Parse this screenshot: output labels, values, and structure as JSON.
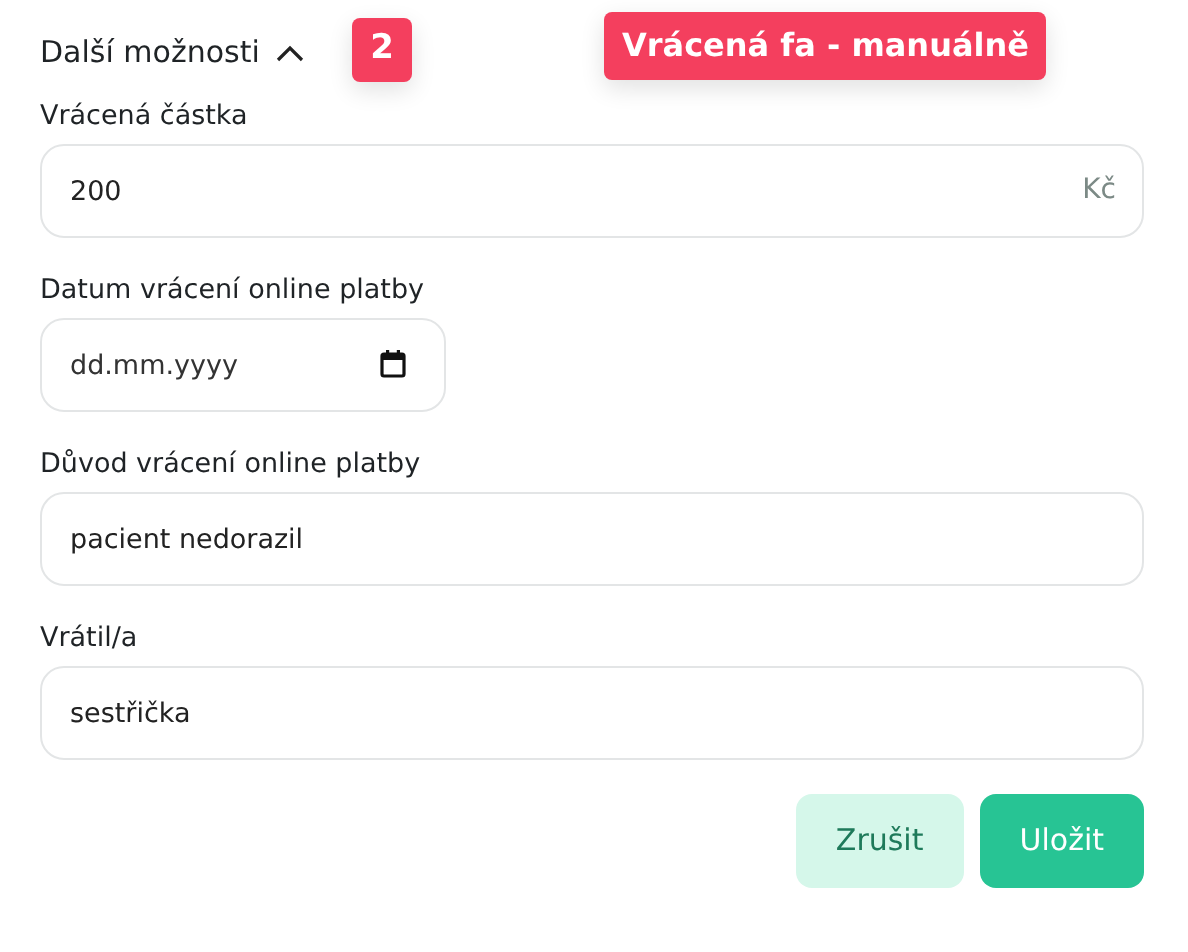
{
  "section": {
    "title": "Další možnosti",
    "expanded": true
  },
  "annotations": [
    {
      "text": "2",
      "kind": "number"
    },
    {
      "text": "Vrácená fa - manuálně",
      "kind": "label"
    }
  ],
  "fields": [
    {
      "kind": "amount",
      "label": "Vrácená částka",
      "value": "200",
      "suffix": "Kč"
    },
    {
      "kind": "date",
      "label": "Datum vrácení online platby",
      "placeholder": "dd.mm.yyyy"
    },
    {
      "kind": "text",
      "label": "Důvod vrácení online platby",
      "value": "pacient nedorazil"
    },
    {
      "kind": "text",
      "label": "Vrátil/a",
      "value": "sestřička"
    }
  ],
  "buttons": [
    {
      "label": "Zrušit",
      "kind": "secondary"
    },
    {
      "label": "Uložit",
      "kind": "primary"
    }
  ]
}
